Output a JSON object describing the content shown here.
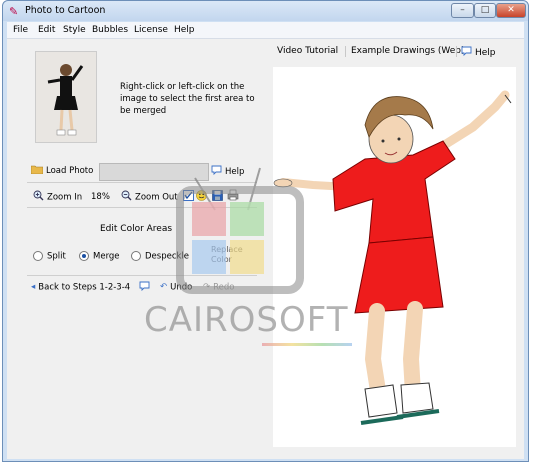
{
  "window": {
    "title": "Photo to Cartoon",
    "min": "–",
    "max": "□",
    "close": "✕"
  },
  "menu": [
    "File",
    "Edit",
    "Style",
    "Bubbles",
    "License",
    "Help"
  ],
  "instructions": "Right-click or left-click on the image to select the first area to be merged",
  "toolbar": {
    "load_photo": "Load Photo",
    "path_value": "",
    "help": "Help",
    "zoom_in": "Zoom In",
    "zoom_value": "18%",
    "zoom_out": "Zoom Out"
  },
  "edit_areas": {
    "title": "Edit Color Areas",
    "modes": [
      {
        "label": "Split",
        "selected": false
      },
      {
        "label": "Merge",
        "selected": true
      },
      {
        "label": "Despeckle",
        "selected": false
      }
    ],
    "replace_color": "Replace Color"
  },
  "nav": {
    "back": "Back to Steps 1-2-3-4",
    "undo": "Undo",
    "redo": "Redo"
  },
  "tabs": {
    "video": "Video Tutorial",
    "examples": "Example Drawings (Web)",
    "help": "Help"
  },
  "watermark": "CAIROSOFT",
  "colors": {
    "accent": "#3a6fc6",
    "dress": "#ee1c1c",
    "hair": "#a57a4a"
  }
}
